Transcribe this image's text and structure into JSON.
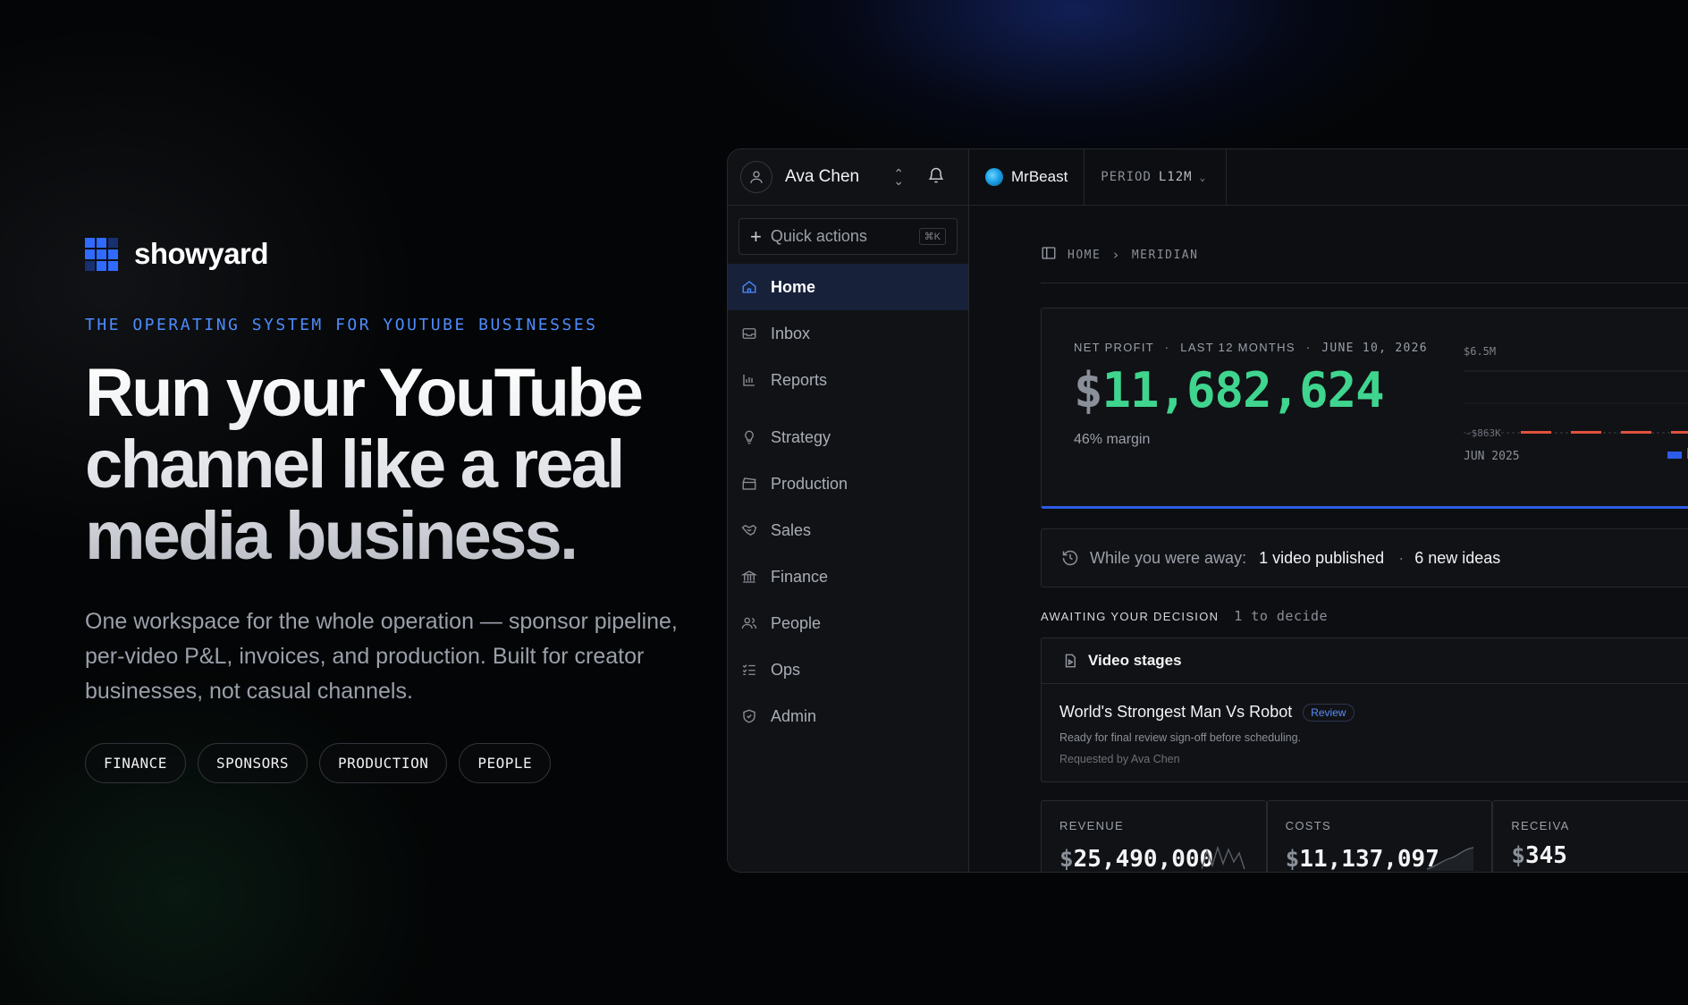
{
  "brand": {
    "name": "showyard"
  },
  "hero": {
    "eyebrow": "THE OPERATING SYSTEM FOR YOUTUBE BUSINESSES",
    "headline_1": "Run your YouTube",
    "headline_2": "channel like a real",
    "headline_3": "media business.",
    "subtext": "One workspace for the whole operation — sponsor pipeline, per-video P&L, invoices, and production. Built for creator businesses, not casual channels.",
    "tags": [
      "FINANCE",
      "SPONSORS",
      "PRODUCTION",
      "PEOPLE"
    ]
  },
  "app": {
    "user": {
      "name": "Ava Chen"
    },
    "quick_actions": {
      "label": "Quick actions",
      "shortcut": "⌘K"
    },
    "nav": [
      {
        "label": "Home",
        "icon": "home-icon",
        "active": true
      },
      {
        "label": "Inbox",
        "icon": "inbox-icon"
      },
      {
        "label": "Reports",
        "icon": "bar-chart-icon"
      },
      {
        "label": "Strategy",
        "icon": "lightbulb-icon"
      },
      {
        "label": "Production",
        "icon": "clapperboard-icon"
      },
      {
        "label": "Sales",
        "icon": "handshake-icon"
      },
      {
        "label": "Finance",
        "icon": "bank-icon"
      },
      {
        "label": "People",
        "icon": "people-icon"
      },
      {
        "label": "Ops",
        "icon": "checklist-icon"
      },
      {
        "label": "Admin",
        "icon": "shield-icon"
      }
    ],
    "channel": {
      "name": "MrBeast"
    },
    "period": {
      "label": "PERIOD",
      "value": "L12M"
    },
    "breadcrumb": {
      "home": "HOME",
      "current": "MERIDIAN"
    },
    "net_profit": {
      "label": "NET PROFIT",
      "sep": "·",
      "range": "LAST 12 MONTHS",
      "date": "JUNE 10, 2026",
      "currency": "$",
      "value": "11,682,624",
      "margin": "46% margin",
      "chart": {
        "y_top": "$6.5M",
        "y_low": "-$863K",
        "x_start": "JUN 2025"
      }
    },
    "away": {
      "label": "While you were away:",
      "item1": "1 video published",
      "sep": "·",
      "item2": "6 new ideas"
    },
    "awaiting": {
      "label": "AWAITING YOUR DECISION",
      "count": "1 to decide"
    },
    "decision": {
      "section": "Video stages",
      "title": "World's Strongest Man Vs Robot",
      "badge": "Review",
      "desc": "Ready for final review sign-off before scheduling.",
      "requested": "Requested by Ava Chen"
    },
    "metrics": [
      {
        "label": "REVENUE",
        "currency": "$",
        "value": "25,490,000"
      },
      {
        "label": "COSTS",
        "currency": "$",
        "value": "11,137,097"
      },
      {
        "label": "RECEIVA",
        "currency": "$",
        "value": "345"
      }
    ],
    "colors": {
      "accent": "#2f6bff",
      "profit": "#3fd58f",
      "negative": "#e0523f"
    }
  }
}
